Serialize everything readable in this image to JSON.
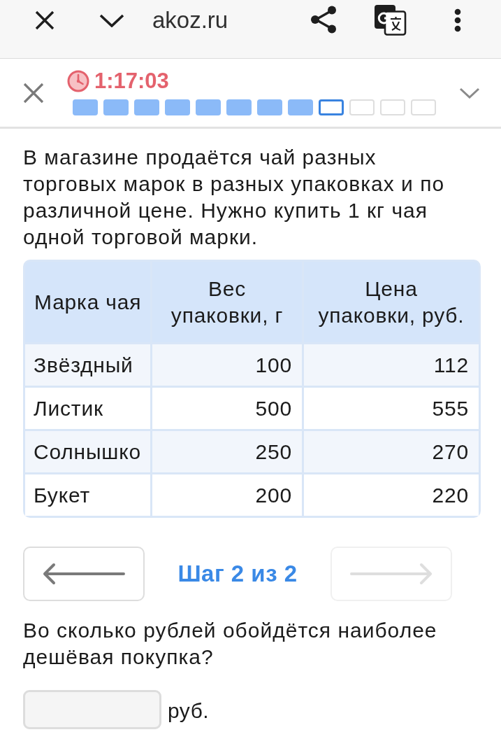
{
  "browser_bar": {
    "url": "akoz.ru"
  },
  "quiz_header": {
    "timer": "1:17:03",
    "progress": [
      {
        "done": true,
        "selected": false
      },
      {
        "done": true,
        "selected": false
      },
      {
        "done": true,
        "selected": false
      },
      {
        "done": true,
        "selected": false
      },
      {
        "done": true,
        "selected": false
      },
      {
        "done": true,
        "selected": false
      },
      {
        "done": true,
        "selected": false
      },
      {
        "done": true,
        "selected": false
      },
      {
        "done": false,
        "selected": true
      },
      {
        "done": false,
        "selected": false
      },
      {
        "done": false,
        "selected": false
      },
      {
        "done": false,
        "selected": false
      }
    ]
  },
  "task_text": "В магазине продаётся чай разных торговых марок в разных упаковках и по различной цене. Нужно купить 1 кг чая одной торговой марки.",
  "table": {
    "columns": [
      "Марка чая",
      "Вес упаковки, г",
      "Цена упаковки, руб."
    ],
    "rows": [
      [
        "Звёздный",
        "100",
        "112"
      ],
      [
        "Листик",
        "500",
        "555"
      ],
      [
        "Солнышко",
        "250",
        "270"
      ],
      [
        "Букет",
        "200",
        "220"
      ]
    ]
  },
  "navigation": {
    "back": {
      "disabled": false
    },
    "step": "Шаг 2 из 2",
    "forward": {
      "disabled": true
    }
  },
  "question": "Во сколько рублей обойдётся наиболее дешёвая покупка?",
  "answer": {
    "unit": "руб."
  }
}
